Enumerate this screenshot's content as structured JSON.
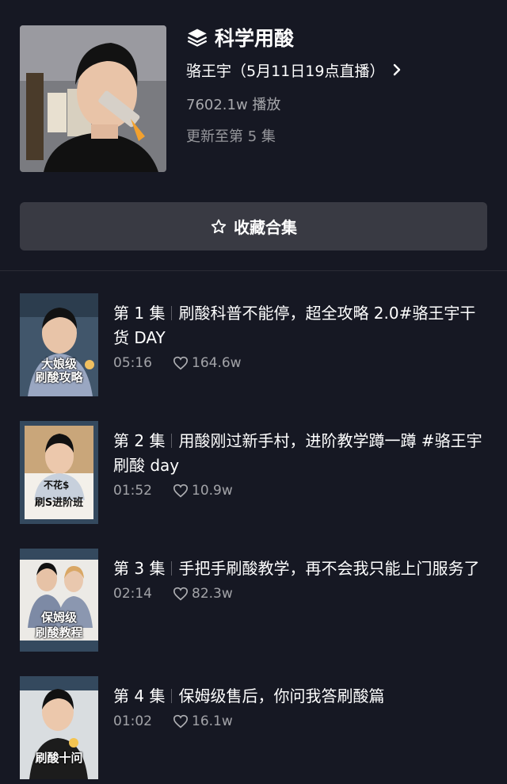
{
  "collection": {
    "title": "科学用酸",
    "author": "骆王宇（5月11日19点直播）",
    "plays": "7602.1w 播放",
    "update_status": "更新至第 5 集",
    "favorite_label": "收藏合集"
  },
  "episodes": [
    {
      "number": "第 1 集",
      "title": "刷酸科普不能停，超全攻略 2.0#骆王宇干货 DAY",
      "duration": "05:16",
      "likes": "164.6w",
      "thumb_text": [
        "大娘级",
        "刷酸攻略"
      ]
    },
    {
      "number": "第 2 集",
      "title": "用酸刚过新手村，进阶教学蹲一蹲 #骆王宇刷酸 day",
      "duration": "01:52",
      "likes": "10.9w",
      "thumb_text": [
        "不花$",
        "刷S进阶班"
      ]
    },
    {
      "number": "第 3 集",
      "title": "手把手刷酸教学，再不会我只能上门服务了",
      "duration": "02:14",
      "likes": "82.3w",
      "thumb_text": [
        "保姆级",
        "刷酸教程"
      ]
    },
    {
      "number": "第 4 集",
      "title": "保姆级售后，你问我答刷酸篇",
      "duration": "01:02",
      "likes": "16.1w",
      "thumb_text": [
        "刷酸十问"
      ]
    }
  ],
  "icons": {
    "collection": "layers-icon",
    "author_link": "chevron-right-icon",
    "favorite": "star-outline-icon",
    "likes": "heart-outline-icon"
  }
}
